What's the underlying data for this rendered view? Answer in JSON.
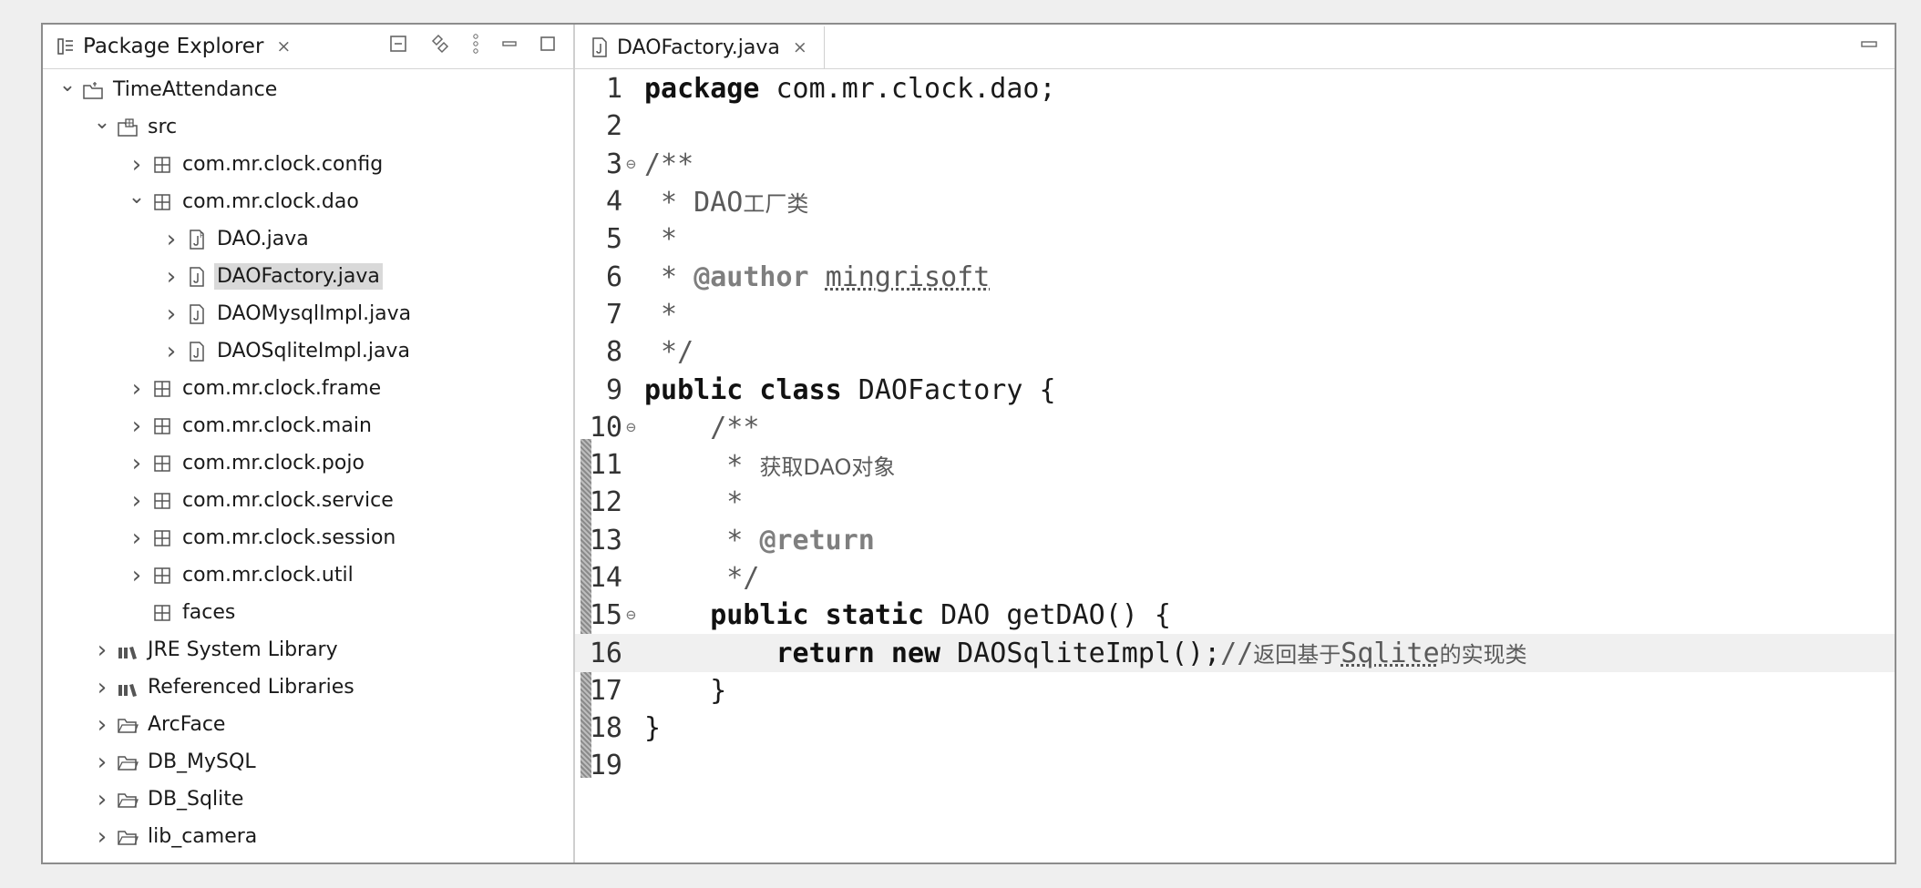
{
  "explorer": {
    "title": "Package Explorer",
    "close": "×",
    "tree": [
      {
        "label": "TimeAttendance",
        "indent": 0,
        "twisty": "v",
        "icon": "project-icon"
      },
      {
        "label": "src",
        "indent": 1,
        "twisty": "v",
        "icon": "source-folder-icon"
      },
      {
        "label": "com.mr.clock.config",
        "indent": 2,
        "twisty": ">",
        "icon": "package-icon"
      },
      {
        "label": "com.mr.clock.dao",
        "indent": 2,
        "twisty": "v",
        "icon": "package-icon"
      },
      {
        "label": "DAO.java",
        "indent": 3,
        "twisty": ">",
        "icon": "interface-file-icon"
      },
      {
        "label": "DAOFactory.java",
        "indent": 3,
        "twisty": ">",
        "icon": "java-file-icon",
        "selected": true
      },
      {
        "label": "DAOMysqlImpl.java",
        "indent": 3,
        "twisty": ">",
        "icon": "java-file-icon"
      },
      {
        "label": "DAOSqliteImpl.java",
        "indent": 3,
        "twisty": ">",
        "icon": "java-file-icon"
      },
      {
        "label": "com.mr.clock.frame",
        "indent": 2,
        "twisty": ">",
        "icon": "package-icon"
      },
      {
        "label": "com.mr.clock.main",
        "indent": 2,
        "twisty": ">",
        "icon": "package-icon"
      },
      {
        "label": "com.mr.clock.pojo",
        "indent": 2,
        "twisty": ">",
        "icon": "package-icon"
      },
      {
        "label": "com.mr.clock.service",
        "indent": 2,
        "twisty": ">",
        "icon": "package-icon"
      },
      {
        "label": "com.mr.clock.session",
        "indent": 2,
        "twisty": ">",
        "icon": "package-icon"
      },
      {
        "label": "com.mr.clock.util",
        "indent": 2,
        "twisty": ">",
        "icon": "package-icon"
      },
      {
        "label": "faces",
        "indent": 2,
        "twisty": "",
        "icon": "package-icon"
      },
      {
        "label": "JRE System Library",
        "indent": 1,
        "twisty": ">",
        "icon": "library-icon"
      },
      {
        "label": "Referenced Libraries",
        "indent": 1,
        "twisty": ">",
        "icon": "library-icon"
      },
      {
        "label": "ArcFace",
        "indent": 1,
        "twisty": ">",
        "icon": "folder-icon"
      },
      {
        "label": "DB_MySQL",
        "indent": 1,
        "twisty": ">",
        "icon": "folder-icon"
      },
      {
        "label": "DB_Sqlite",
        "indent": 1,
        "twisty": ">",
        "icon": "folder-icon"
      },
      {
        "label": "lib_camera",
        "indent": 1,
        "twisty": ">",
        "icon": "folder-icon"
      }
    ]
  },
  "editor": {
    "tab_label": "DAOFactory.java",
    "close": "×",
    "lines": [
      {
        "n": "1",
        "fold": "",
        "html": "<span class=\"kw\">package</span> com.mr.clock.dao;"
      },
      {
        "n": "2",
        "fold": "",
        "html": ""
      },
      {
        "n": "3",
        "fold": "⊖",
        "html": "<span class=\"cm\">/**</span>"
      },
      {
        "n": "4",
        "fold": "",
        "html": "<span class=\"cm\"> * DAO<span class=\"cjk\">工厂类</span></span>"
      },
      {
        "n": "5",
        "fold": "",
        "html": "<span class=\"cm\"> *</span>"
      },
      {
        "n": "6",
        "fold": "",
        "html": "<span class=\"cm\"> * <span class=\"tag\">@author</span> <span class=\"under\">mingrisoft</span></span>"
      },
      {
        "n": "7",
        "fold": "",
        "html": "<span class=\"cm\"> *</span>"
      },
      {
        "n": "8",
        "fold": "",
        "html": "<span class=\"cm\"> */</span>"
      },
      {
        "n": "9",
        "fold": "",
        "html": "<span class=\"kw\">public class</span> DAOFactory {"
      },
      {
        "n": "10",
        "fold": "⊖",
        "html": "    <span class=\"cm\">/**</span>"
      },
      {
        "n": "11",
        "fold": "",
        "html": "<span class=\"cm\">     * <span class=\"cjk\">获取DAO对象</span></span>"
      },
      {
        "n": "12",
        "fold": "",
        "html": "<span class=\"cm\">     *</span>"
      },
      {
        "n": "13",
        "fold": "",
        "html": "<span class=\"cm\">     * <span class=\"tag\">@return</span></span>"
      },
      {
        "n": "14",
        "fold": "",
        "html": "<span class=\"cm\">     */</span>"
      },
      {
        "n": "15",
        "fold": "⊖",
        "html": "    <span class=\"kw\">public static</span> DAO getDAO() {"
      },
      {
        "n": "16",
        "fold": "",
        "hl": true,
        "html": "        <span class=\"kw\">return new</span> DAOSqliteImpl();<span class=\"cm\">//<span class=\"cjk\">返回基于</span><span class=\"under\">Sqlite</span><span class=\"cjk\">的实现类</span></span>"
      },
      {
        "n": "17",
        "fold": "",
        "html": "    }"
      },
      {
        "n": "18",
        "fold": "",
        "html": "}"
      },
      {
        "n": "19",
        "fold": "",
        "html": ""
      }
    ]
  }
}
